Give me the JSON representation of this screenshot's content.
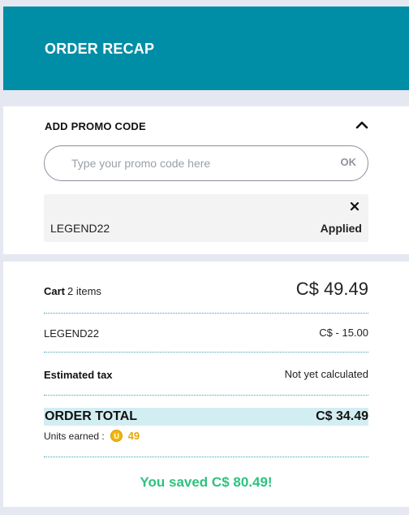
{
  "header": {
    "title": "ORDER RECAP"
  },
  "promo": {
    "title": "ADD PROMO CODE",
    "input_placeholder": "Type your promo code here",
    "input_value": "",
    "ok_label": "OK",
    "applied": {
      "code": "LEGEND22",
      "status": "Applied"
    }
  },
  "summary": {
    "cart": {
      "label": "Cart",
      "count": "2 items",
      "amount": "C$ 49.49"
    },
    "discount": {
      "label": "LEGEND22",
      "amount": "C$ - 15.00"
    },
    "tax": {
      "label": "Estimated tax",
      "value": "Not yet calculated"
    },
    "total": {
      "label": "ORDER TOTAL",
      "amount": "C$ 34.49"
    },
    "units": {
      "label": "Units earned :",
      "coin_glyph": "U",
      "value": "49"
    },
    "saved_message": "You saved C$ 80.49!"
  },
  "colors": {
    "header_bg": "#008ea6",
    "page_bg": "#e6e8f1",
    "total_highlight": "#d3eef2",
    "saved_green": "#2ec27e",
    "units_gold": "#e7a600"
  },
  "icons": {
    "collapse": "chevron-up-icon",
    "remove_promo": "close-icon",
    "units": "units-coin-icon"
  }
}
